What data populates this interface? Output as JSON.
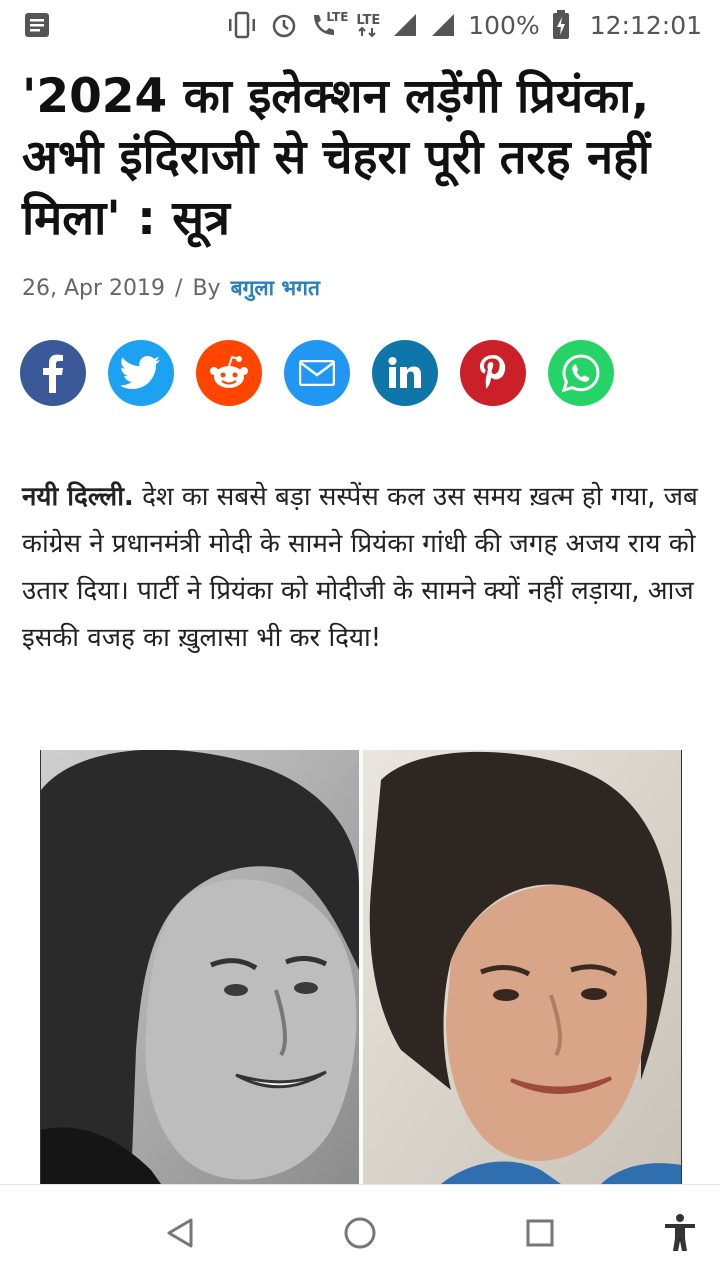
{
  "status_bar": {
    "battery_percent": "100%",
    "time": "12:12:01",
    "network_labels": [
      "LTE",
      "LTE"
    ],
    "icons": [
      "notification-icon",
      "vibrate-icon",
      "alarm-icon",
      "volte-call-icon",
      "lte-data-icon",
      "signal-icon",
      "signal-icon-2",
      "battery-charging-icon"
    ]
  },
  "article": {
    "headline": "'2024 का इलेक्शन लड़ेंगी प्रियंका, अभी इंदिराजी से चेहरा पूरी तरह नहीं मिला' : सूत्र",
    "date": "26, Apr 2019",
    "separator": "/",
    "by_label": "By",
    "author": "बगुला भगत",
    "place": "नयी दिल्ली.",
    "body": "देश का सबसे बड़ा सस्पेंस कल उस समय ख़त्म हो गया, जब कांग्रेस ने प्रधानमंत्री मोदी के सामने प्रियंका गांधी की जगह अजय राय को उतार दिया। पार्टी ने प्रियंका को मोदीजी के सामने क्यों नहीं लड़ाया, आज इसकी वजह का ख़ुलासा भी कर दिया!"
  },
  "share": [
    {
      "name": "facebook",
      "icon": "facebook-icon",
      "color": "#3b5998"
    },
    {
      "name": "twitter",
      "icon": "twitter-icon",
      "color": "#1da1f2"
    },
    {
      "name": "reddit",
      "icon": "reddit-icon",
      "color": "#ff4500"
    },
    {
      "name": "email",
      "icon": "email-icon",
      "color": "#2196f3"
    },
    {
      "name": "linkedin",
      "icon": "linkedin-icon",
      "color": "#0e76a8"
    },
    {
      "name": "pinterest",
      "icon": "pinterest-icon",
      "color": "#cb2027"
    },
    {
      "name": "whatsapp",
      "icon": "whatsapp-icon",
      "color": "#25d366"
    }
  ],
  "nav_bar": {
    "icons": [
      "back-icon",
      "home-icon",
      "recents-icon",
      "accessibility-icon"
    ]
  }
}
